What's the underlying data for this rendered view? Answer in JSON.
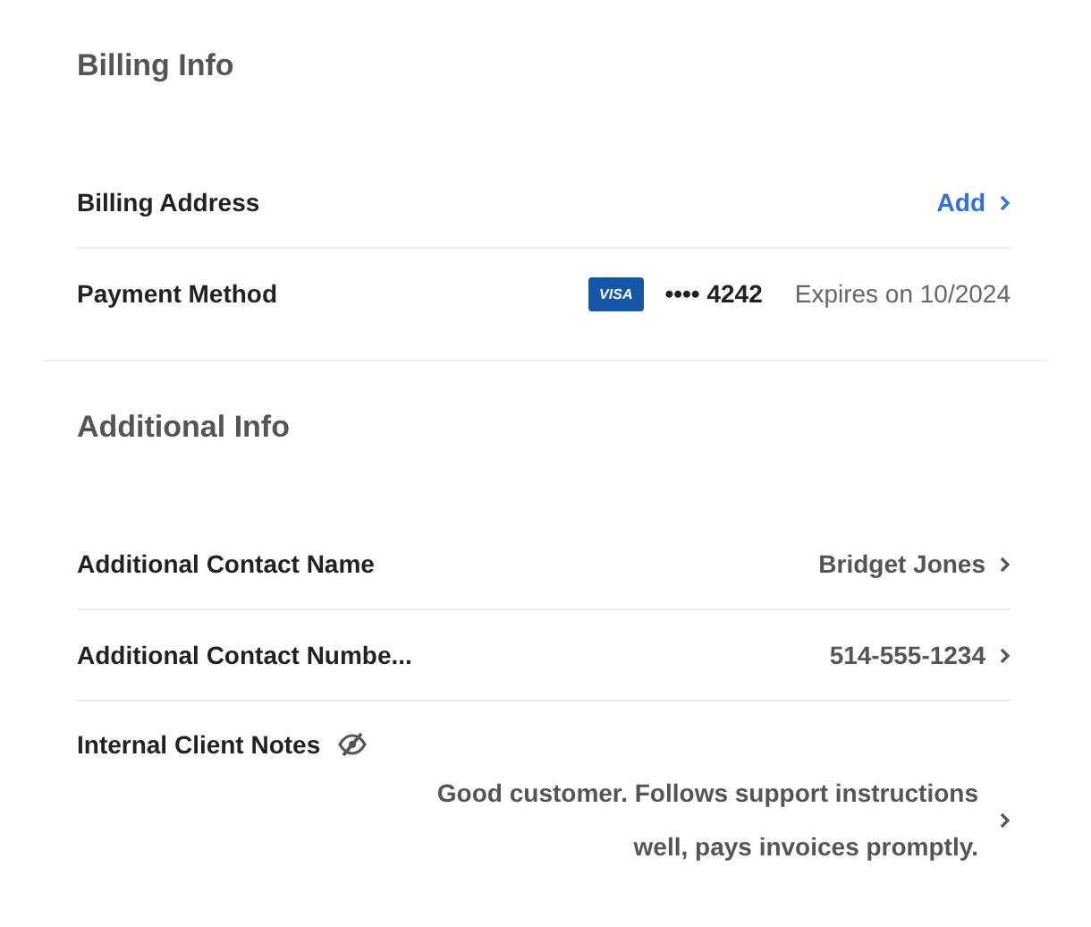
{
  "sections": [
    {
      "title": "Billing Info",
      "rows": [
        {
          "kind": "link",
          "label": "Billing Address",
          "value": "Add"
        },
        {
          "kind": "payment",
          "label": "Payment Method",
          "card_brand": "VISA",
          "card_number": "•••• 4242",
          "expiry": "Expires on 10/2024"
        }
      ]
    },
    {
      "title": "Additional Info",
      "rows": [
        {
          "kind": "value",
          "label": "Additional Contact Name",
          "value": "Bridget Jones"
        },
        {
          "kind": "value",
          "label": "Additional Contact Numbe...",
          "value": "514-555-1234"
        },
        {
          "kind": "notes",
          "label": "Internal Client Notes",
          "value": "Good customer. Follows support instructions well, pays invoices promptly."
        }
      ]
    }
  ]
}
